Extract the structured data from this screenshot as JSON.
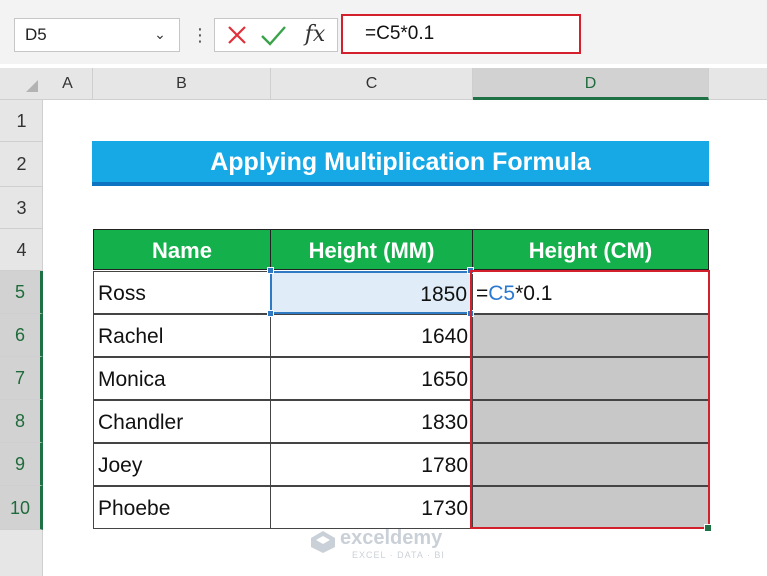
{
  "formula_bar": {
    "name_box": "D5",
    "formula": "=C5*0.1",
    "fx_label": "fx"
  },
  "columns": [
    "A",
    "B",
    "C",
    "D"
  ],
  "rows": [
    "1",
    "2",
    "3",
    "4",
    "5",
    "6",
    "7",
    "8",
    "9",
    "10"
  ],
  "title": "Applying Multiplication Formula",
  "table": {
    "headers": [
      "Name",
      "Height (MM)",
      "Height (CM)"
    ],
    "rows": [
      {
        "name": "Ross",
        "mm": "1850"
      },
      {
        "name": "Rachel",
        "mm": "1640"
      },
      {
        "name": "Monica",
        "mm": "1650"
      },
      {
        "name": "Chandler",
        "mm": "1830"
      },
      {
        "name": "Joey",
        "mm": "1780"
      },
      {
        "name": "Phoebe",
        "mm": "1730"
      }
    ],
    "active_cell_formula": {
      "prefix": "=",
      "ref": "C5",
      "suffix": "*0.1"
    }
  },
  "watermark": {
    "name": "exceldemy",
    "tagline": "EXCEL · DATA · BI"
  },
  "colors": {
    "header_green": "#14b04b",
    "banner_blue": "#17a8e6",
    "highlight_red": "#d4202c",
    "selection_blue": "#2f7ac2"
  }
}
